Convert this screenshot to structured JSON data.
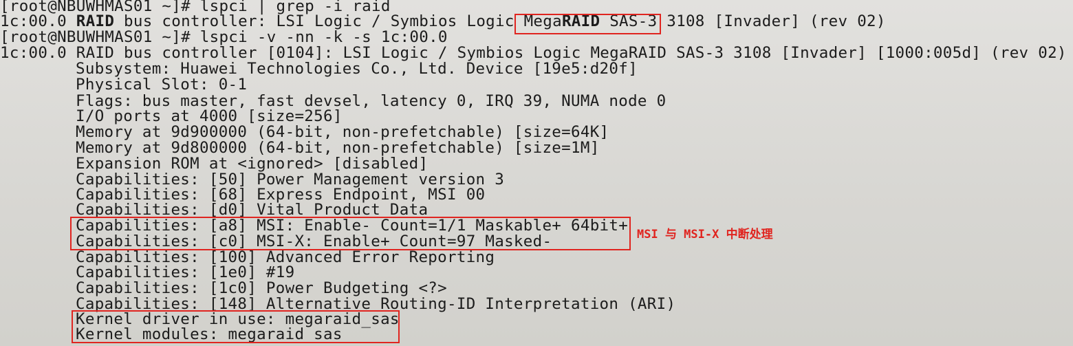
{
  "terminal": {
    "l1_prompt": "[root@NBUWHMAS01 ~]# lspci | grep -i raid",
    "l2_addr": "1c:00.0 ",
    "l2_raid": "RAID",
    "l2_mid": " bus controller: LSI Logic / Symbios Logic ",
    "l2_mega": "Mega",
    "l2_raid2": "RAID",
    "l2_sas": " SAS-3",
    "l2_rest": " 3108 [Invader] (rev 02)",
    "l3_prompt": "[root@NBUWHMAS01 ~]# lspci -v -nn -k -s 1c:00.0",
    "l4": "1c:00.0 RAID bus controller [0104]: LSI Logic / Symbios Logic MegaRAID SAS-3 3108 [Invader] [1000:005d] (rev 02)",
    "details": [
      "Subsystem: Huawei Technologies Co., Ltd. Device [19e5:d20f]",
      "Physical Slot: 0-1",
      "Flags: bus master, fast devsel, latency 0, IRQ 39, NUMA node 0",
      "I/O ports at 4000 [size=256]",
      "Memory at 9d900000 (64-bit, non-prefetchable) [size=64K]",
      "Memory at 9d800000 (64-bit, non-prefetchable) [size=1M]",
      "Expansion ROM at <ignored> [disabled]",
      "Capabilities: [50] Power Management version 3",
      "Capabilities: [68] Express Endpoint, MSI 00",
      "Capabilities: [d0] Vital Product Data",
      "Capabilities: [a8] MSI: Enable- Count=1/1 Maskable+ 64bit+",
      "Capabilities: [c0] MSI-X: Enable+ Count=97 Masked-",
      "Capabilities: [100] Advanced Error Reporting",
      "Capabilities: [1e0] #19",
      "Capabilities: [1c0] Power Budgeting <?>",
      "Capabilities: [148] Alternative Routing-ID Interpretation (ARI)",
      "Kernel driver in use: megaraid_sas",
      "Kernel modules: megaraid_sas"
    ]
  },
  "annotations": {
    "msi_note": "MSI 与 MSI-X 中断处理"
  },
  "colors": {
    "highlight": "#e0241f",
    "text": "#1c1c1c",
    "background": "#dcdbd7"
  }
}
